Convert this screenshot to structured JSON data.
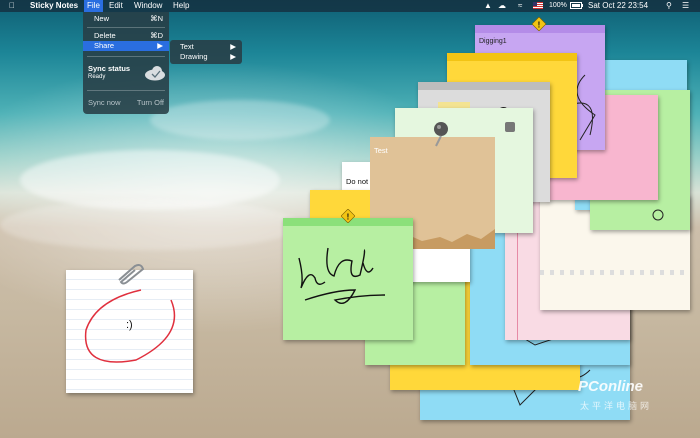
{
  "menubar": {
    "app_name": "Sticky Notes",
    "items": [
      "File",
      "Edit",
      "Window",
      "Help"
    ],
    "battery": "100%",
    "datetime": "Sat Oct 22  23:54"
  },
  "file_menu": {
    "new_label": "New",
    "new_shortcut": "⌘N",
    "delete_label": "Delete",
    "delete_shortcut": "⌘D",
    "share_label": "Share",
    "sync_title": "Sync status",
    "sync_state": "Ready",
    "sync_now": "Sync now",
    "turn_off": "Turn Off"
  },
  "share_submenu": {
    "text": "Text",
    "drawing": "Drawing"
  },
  "notes": {
    "digging_title": "Digging1",
    "test_title": "Test",
    "do_not_text": "Do not",
    "white_note_text": ":)"
  },
  "watermark": {
    "brand": "PConline",
    "cn": "太平洋电脑网"
  },
  "colors": {
    "menu_highlight": "#2a6ee0",
    "note_yellow": "#ffd83a",
    "note_purple": "#c7a6f2",
    "note_blue": "#8fdcf5",
    "note_pink": "#f8b6cf",
    "note_green": "#b7efa2",
    "note_tan": "#e0c297",
    "warning": "#f2c414"
  }
}
